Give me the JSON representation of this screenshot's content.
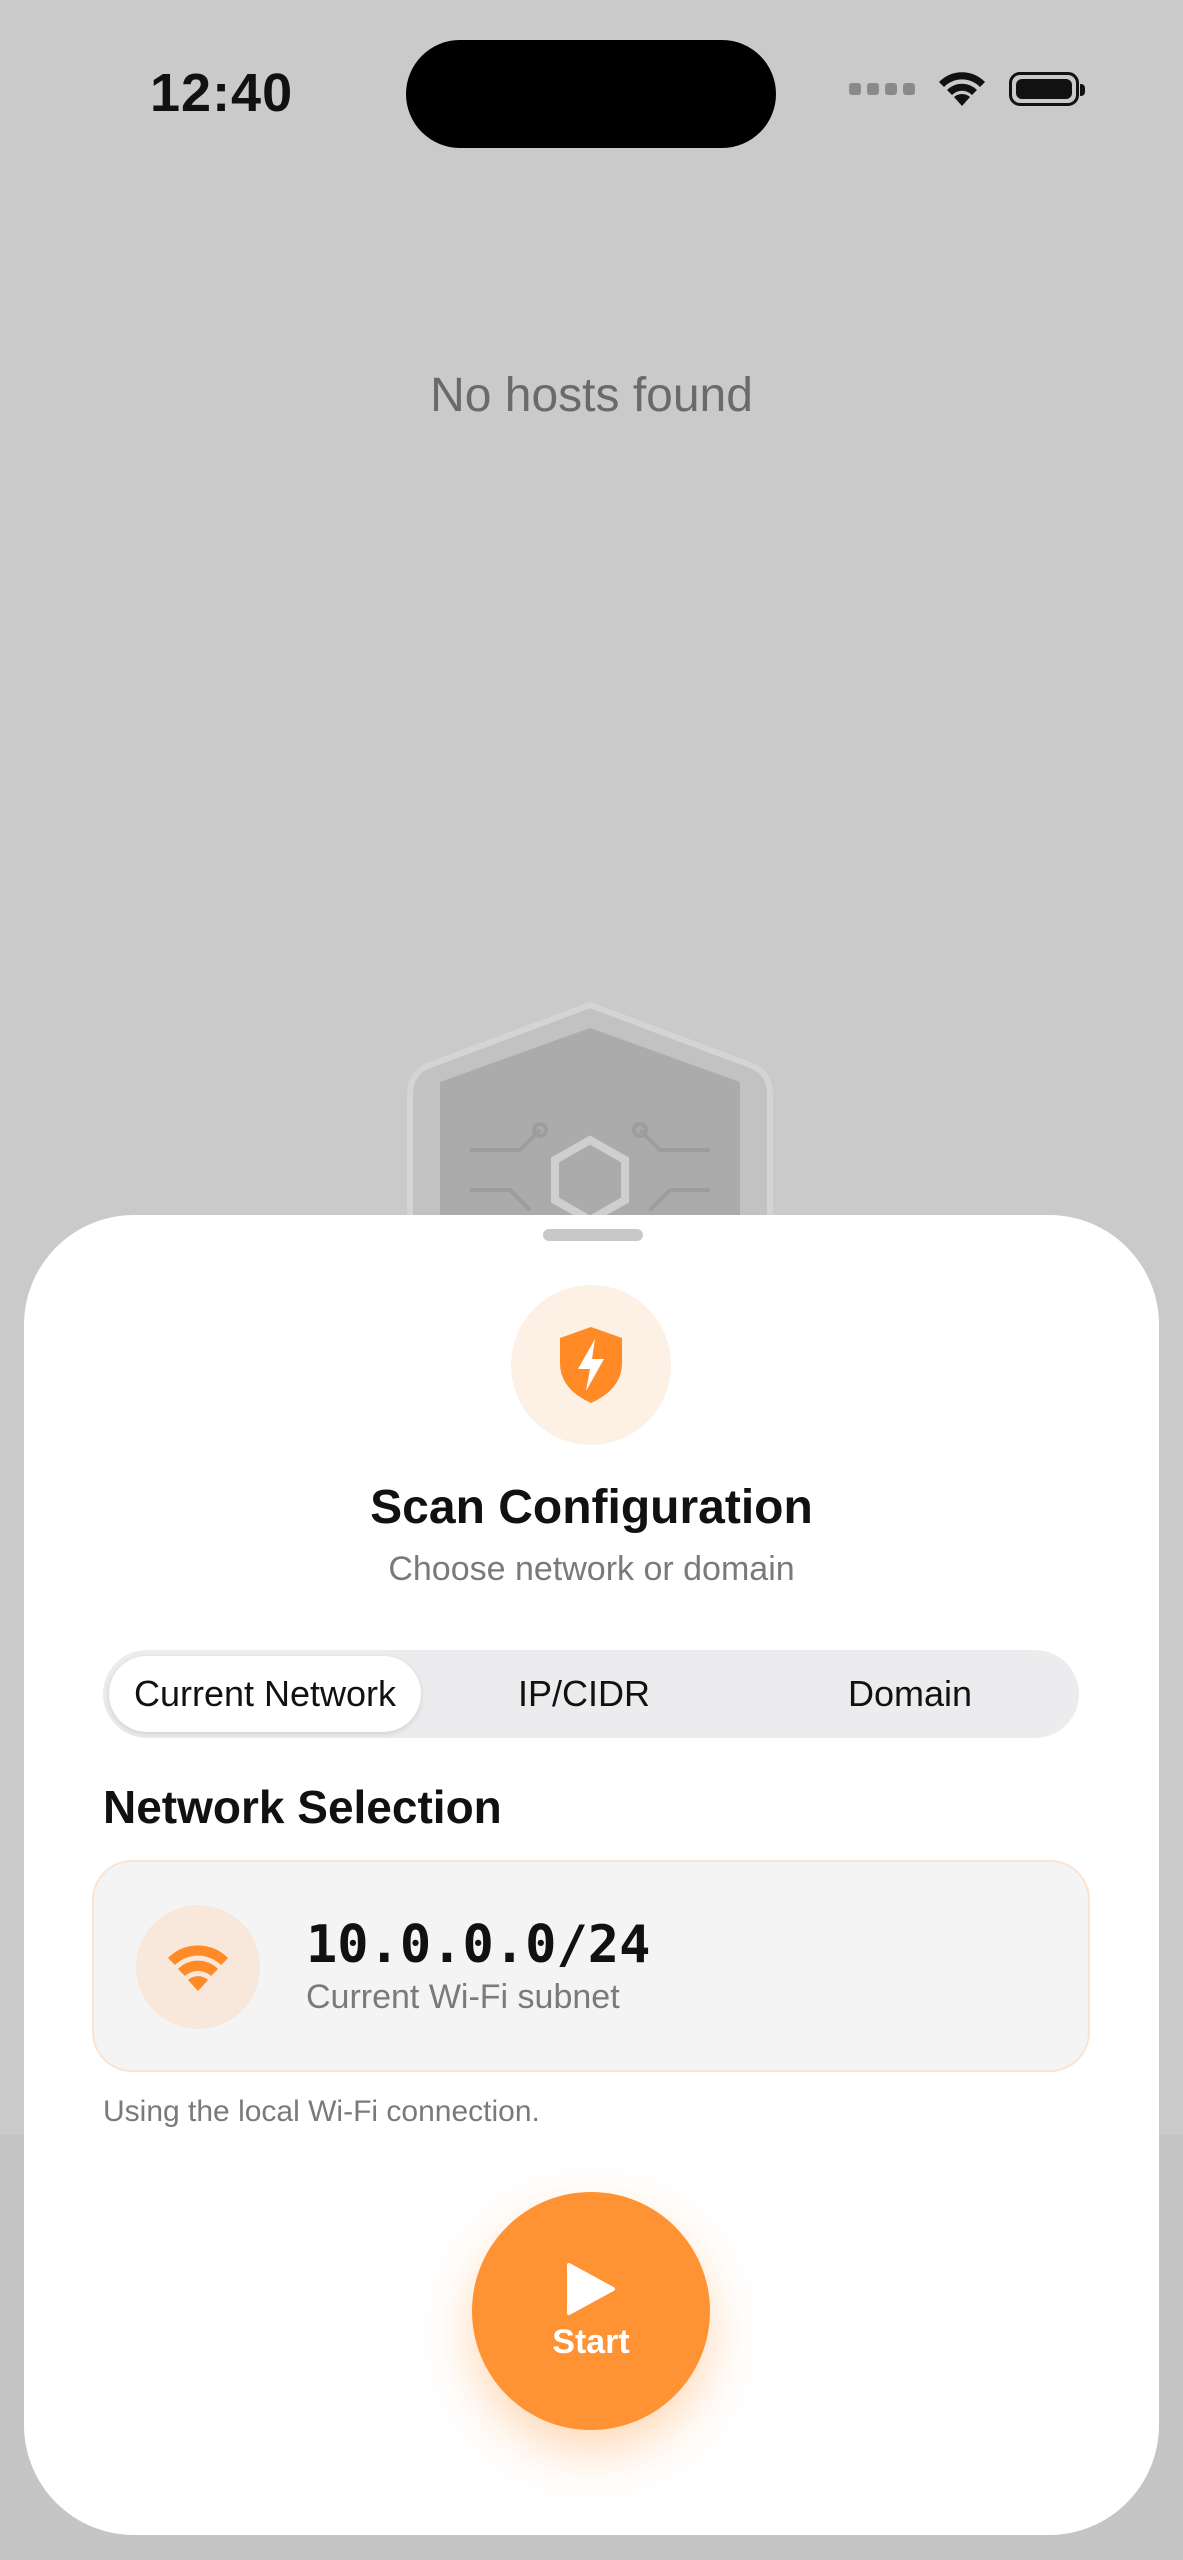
{
  "status_bar": {
    "time": "12:40"
  },
  "empty_state": {
    "message": "No hosts found"
  },
  "sheet": {
    "title": "Scan Configuration",
    "subtitle": "Choose network or domain",
    "tabs": [
      {
        "label": "Current Network",
        "selected": true
      },
      {
        "label": "IP/CIDR",
        "selected": false
      },
      {
        "label": "Domain",
        "selected": false
      }
    ],
    "section_title": "Network Selection",
    "network": {
      "subnet": "10.0.0.0/24",
      "label": "Current Wi-Fi subnet",
      "icon": "wifi-icon"
    },
    "hint": "Using the local Wi-Fi connection.",
    "start_label": "Start"
  },
  "colors": {
    "accent": "#ff9232",
    "accent_soft": "#fdf0e4",
    "backdrop": "#cacaca"
  }
}
